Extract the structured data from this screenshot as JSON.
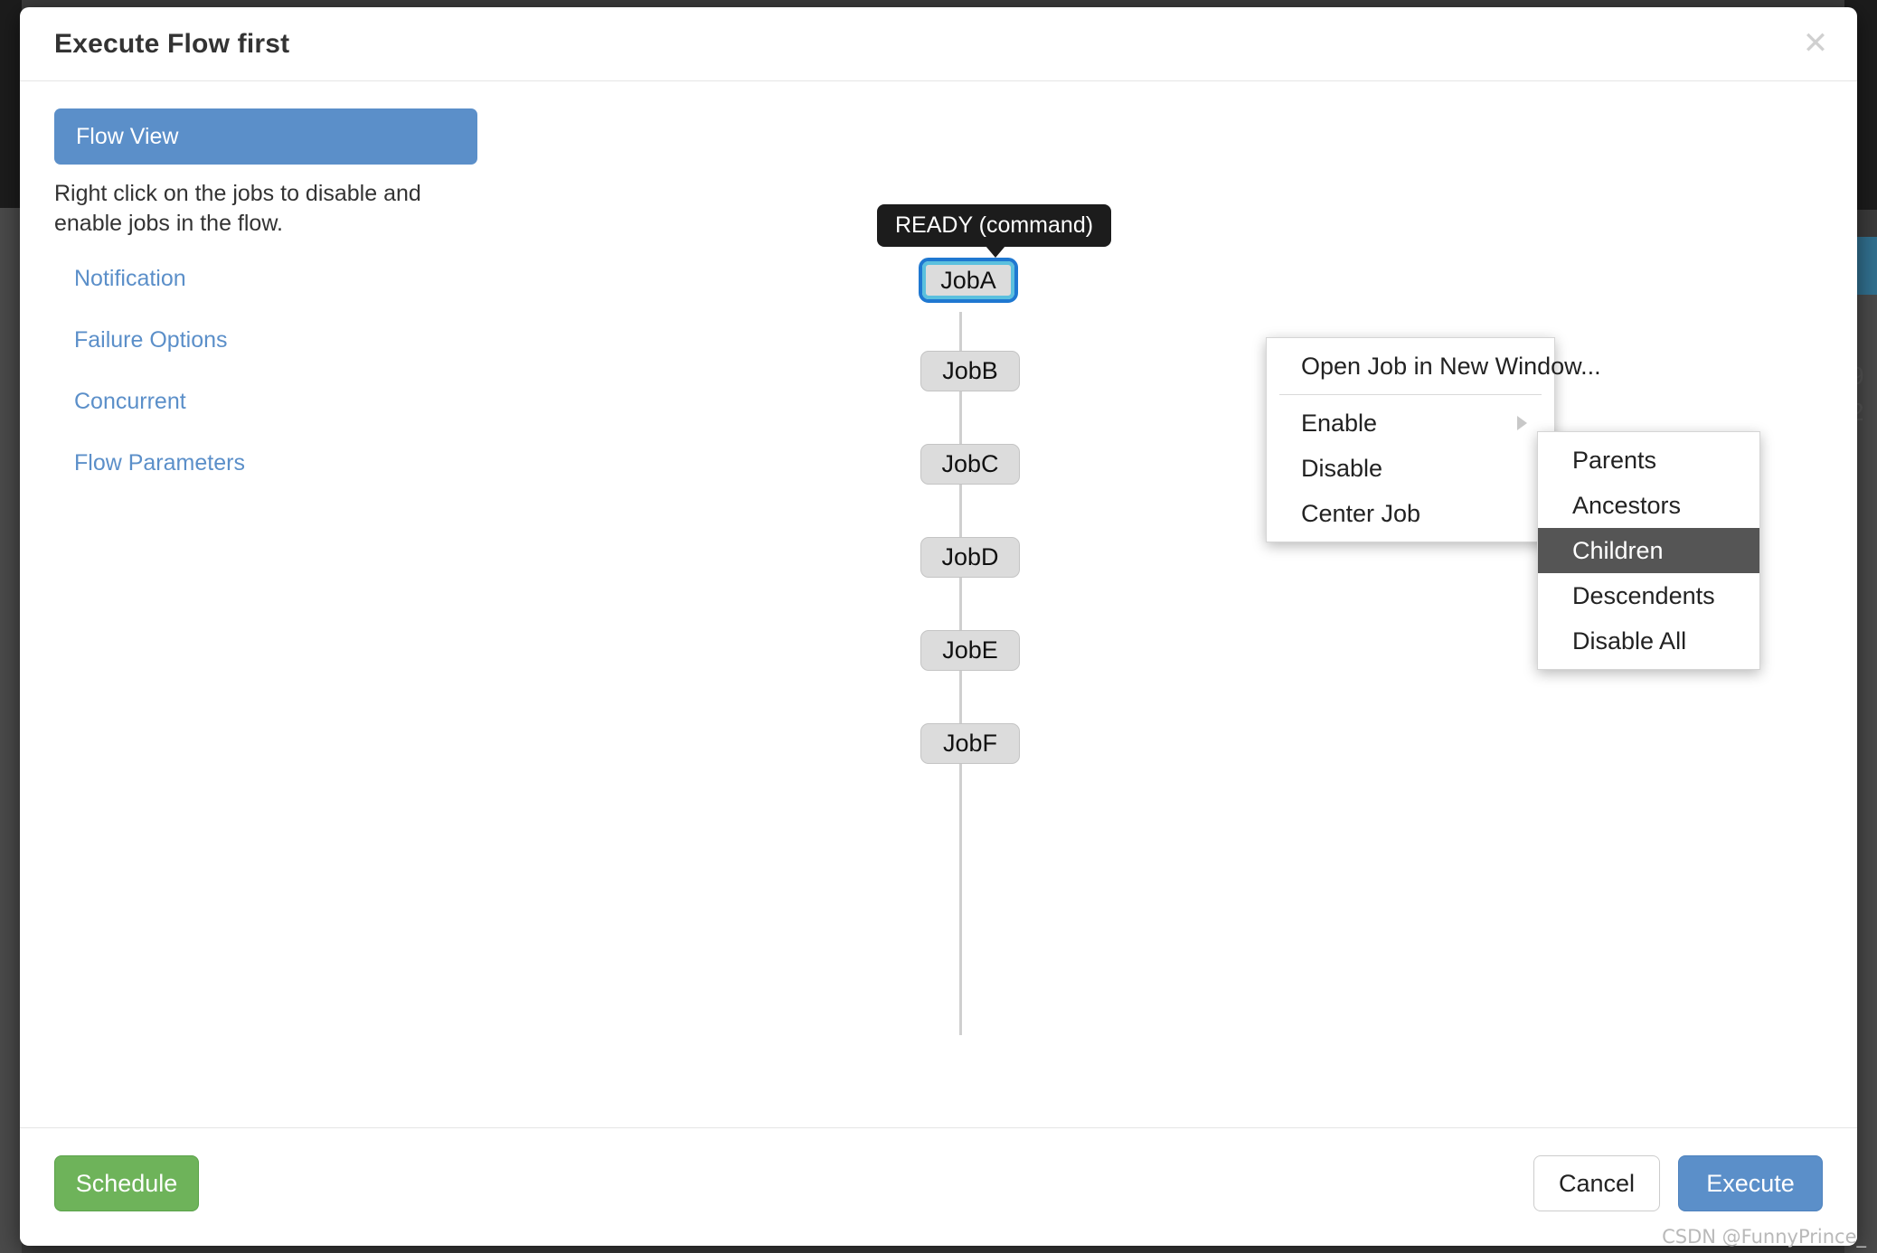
{
  "modal": {
    "title": "Execute Flow first",
    "close_icon": "close-icon"
  },
  "sidebar": {
    "active_tab": "Flow View",
    "description": "Right click on the jobs to disable and enable jobs in the flow.",
    "links": [
      {
        "label": "Notification"
      },
      {
        "label": "Failure Options"
      },
      {
        "label": "Concurrent"
      },
      {
        "label": "Flow Parameters"
      }
    ]
  },
  "graph": {
    "tooltip": "READY (command)",
    "nodes": [
      {
        "label": "JobA",
        "selected": true
      },
      {
        "label": "JobB",
        "selected": false
      },
      {
        "label": "JobC",
        "selected": false
      },
      {
        "label": "JobD",
        "selected": false
      },
      {
        "label": "JobE",
        "selected": false
      },
      {
        "label": "JobF",
        "selected": false
      }
    ]
  },
  "context_menu": {
    "items": [
      {
        "label": "Open Job in New Window...",
        "has_submenu": false
      },
      {
        "label": "Enable",
        "has_submenu": true
      },
      {
        "label": "Disable",
        "has_submenu": false
      },
      {
        "label": "Center Job",
        "has_submenu": false
      }
    ],
    "submenu": [
      {
        "label": "Parents",
        "highlighted": false
      },
      {
        "label": "Ancestors",
        "highlighted": false
      },
      {
        "label": "Children",
        "highlighted": true
      },
      {
        "label": "Descendents",
        "highlighted": false
      },
      {
        "label": "Disable All",
        "highlighted": false
      }
    ]
  },
  "footer": {
    "schedule_label": "Schedule",
    "cancel_label": "Cancel",
    "execute_label": "Execute"
  },
  "watermark": "CSDN @FunnyPrince_",
  "colors": {
    "accent_blue": "#5b8fc9",
    "selected_border": "#1f78d1",
    "selected_ring": "#5bc0de",
    "green": "#6eb35a",
    "menu_highlight": "#555555",
    "tooltip_bg": "#1c1c1c",
    "node_bg": "#dcdcdc"
  }
}
